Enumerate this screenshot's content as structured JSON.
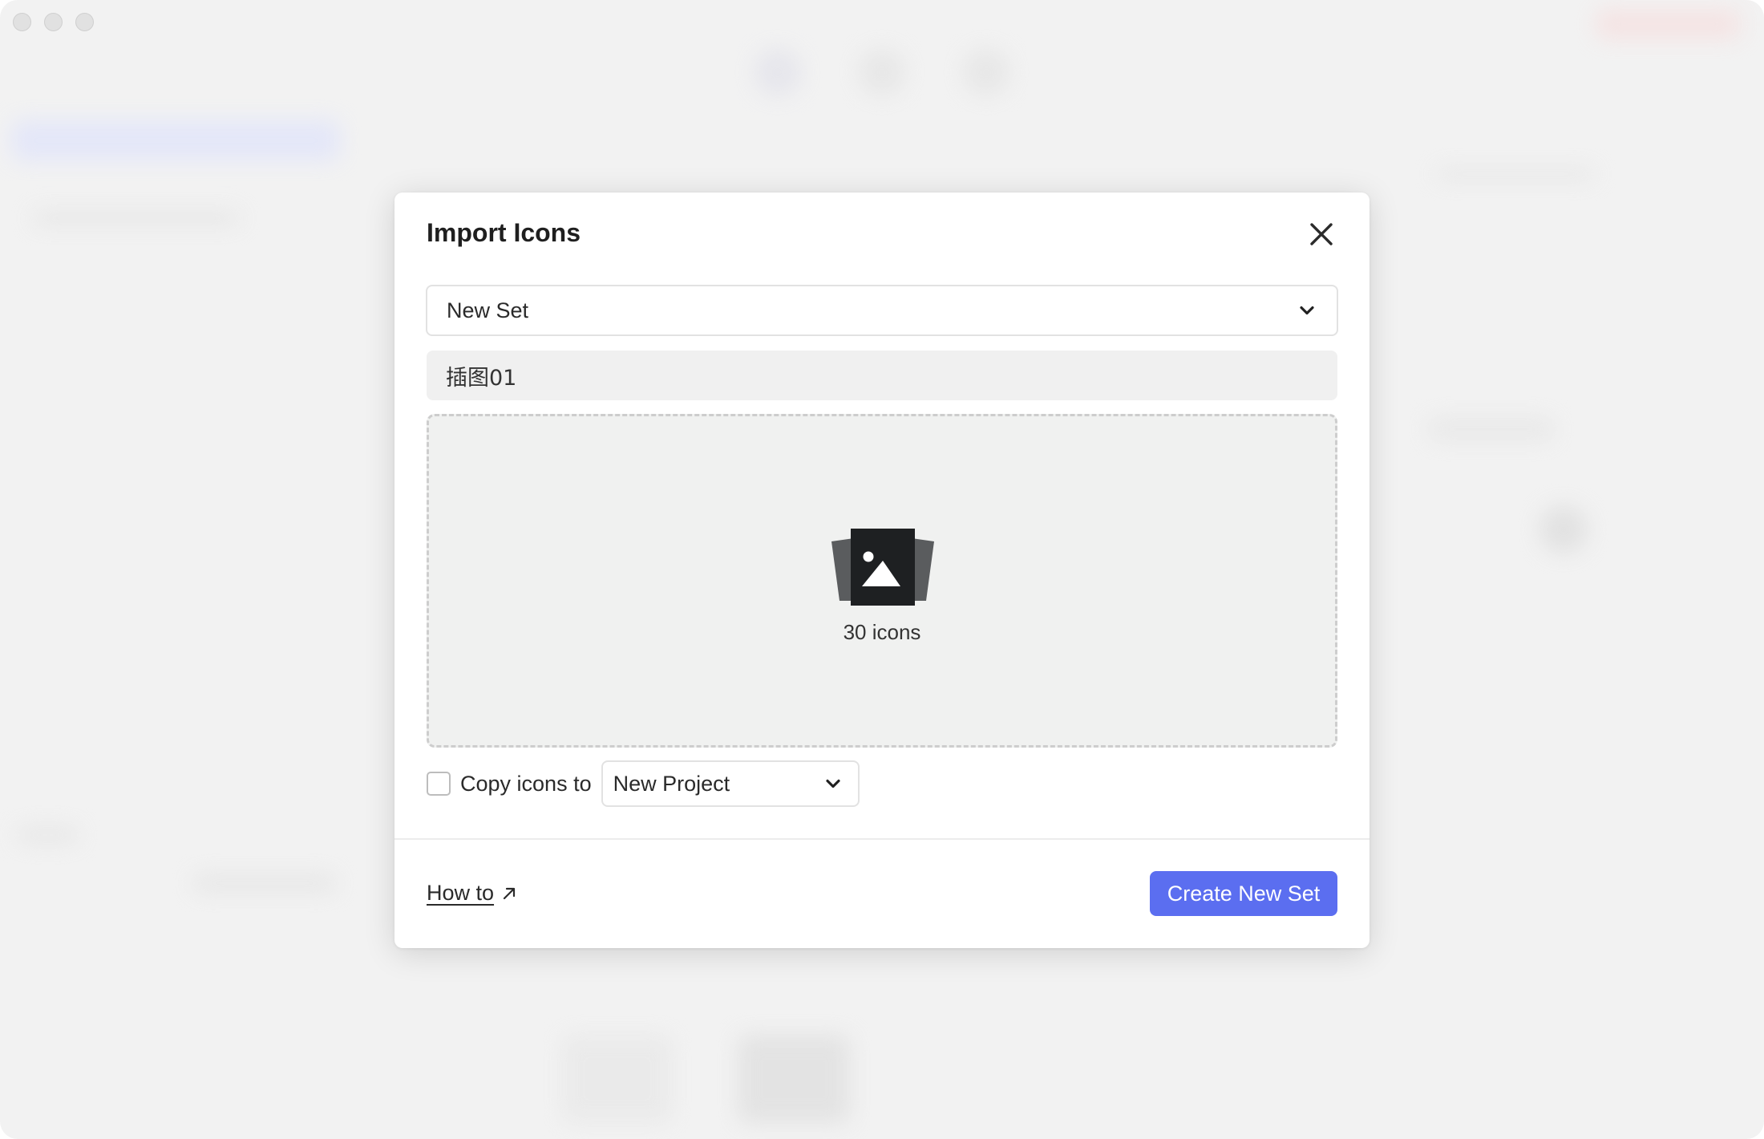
{
  "window": {
    "traffic_lights": [
      "close",
      "minimize",
      "zoom"
    ]
  },
  "dialog": {
    "title": "Import Icons",
    "close_icon": "close-icon",
    "set_select": {
      "value": "New Set",
      "icon": "chevron-down-icon"
    },
    "name_input": {
      "value": "插图01"
    },
    "dropzone": {
      "icon": "image-stack-icon",
      "count_label": "30 icons"
    },
    "copy_option": {
      "checked": false,
      "label": "Copy icons to",
      "project_select": {
        "value": "New Project",
        "icon": "chevron-down-icon"
      }
    },
    "footer": {
      "howto_label": "How to",
      "howto_icon": "external-link-icon",
      "create_button": "Create New Set"
    }
  },
  "colors": {
    "accent": "#5b6ef0",
    "window_bg": "#f2f2f2",
    "dropzone_bg": "#f0f1f0",
    "input_bg": "#f0f0f0"
  }
}
